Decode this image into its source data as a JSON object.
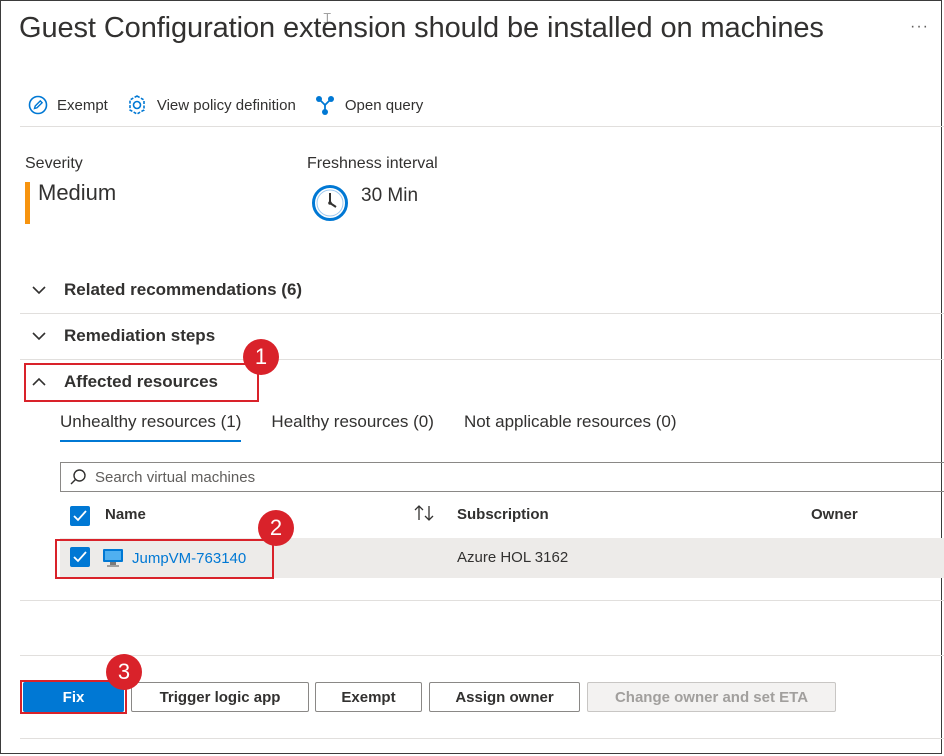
{
  "header": {
    "title": "Guest Configuration extension should be installed on machines",
    "more_label": "···"
  },
  "toolbar": {
    "exempt_label": "Exempt",
    "view_policy_label": "View policy definition",
    "open_query_label": "Open query"
  },
  "summary": {
    "severity_label": "Severity",
    "severity_value": "Medium",
    "severity_color": "#f7940f",
    "freshness_label": "Freshness interval",
    "freshness_value": "30 Min"
  },
  "sections": {
    "related": "Related recommendations (6)",
    "remediation": "Remediation steps",
    "affected": "Affected resources"
  },
  "tabs": {
    "unhealthy": "Unhealthy resources (1)",
    "healthy": "Healthy resources (0)",
    "not_applicable": "Not applicable resources (0)"
  },
  "search": {
    "placeholder": "Search virtual machines"
  },
  "table": {
    "columns": {
      "name": "Name",
      "subscription": "Subscription",
      "owner": "Owner"
    },
    "rows": [
      {
        "name": "JumpVM-763140",
        "subscription": "Azure HOL 3162",
        "owner": "",
        "checked": true
      }
    ]
  },
  "actions": {
    "fix": "Fix",
    "trigger": "Trigger logic app",
    "exempt": "Exempt",
    "assign_owner": "Assign owner",
    "change_owner": "Change owner and set ETA"
  },
  "callouts": [
    "1",
    "2",
    "3"
  ],
  "colors": {
    "accent": "#0078d4",
    "callout": "#d9222a"
  }
}
